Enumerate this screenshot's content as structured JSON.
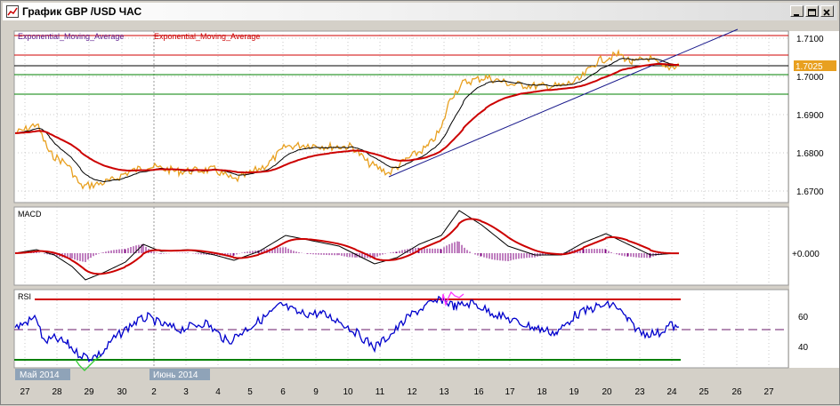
{
  "window": {
    "title": "График GBP /USD  ЧАС",
    "controls": [
      "minimize",
      "maximize",
      "close"
    ]
  },
  "price_panel": {
    "indicator_label_1": "Exponential_Moving_Average",
    "indicator_label_2": "Exponential_Moving_Average",
    "current_price": "1.7025",
    "y_ticks": [
      "1.7100",
      "1.7000",
      "1.6900",
      "1.6800",
      "1.6700"
    ]
  },
  "macd_panel": {
    "label": "MACD",
    "zero_tick": "+0.000"
  },
  "rsi_panel": {
    "label": "RSI",
    "y_ticks": [
      "60",
      "40"
    ]
  },
  "time_axis": {
    "day_labels": [
      "27",
      "28",
      "29",
      "30",
      "2",
      "3",
      "4",
      "5",
      "6",
      "9",
      "10",
      "11",
      "12",
      "13",
      "16",
      "17",
      "18",
      "19",
      "20",
      "23",
      "24",
      "25",
      "26",
      "27"
    ],
    "month_labels": [
      "Май 2014",
      "Июнь 2014"
    ]
  },
  "colors": {
    "price_line": "#e8a020",
    "ema_fast": "#000000",
    "ema_slow": "#cc0000",
    "trendline": "#1a1a8c",
    "resistance": "#d00000",
    "support": "#008000",
    "current_price_tag": "#e8a020",
    "macd_hist": "#800080",
    "rsi_line": "#0000cc",
    "rsi_overbought": "#ff33ff",
    "rsi_oversold": "#33cc33"
  }
}
